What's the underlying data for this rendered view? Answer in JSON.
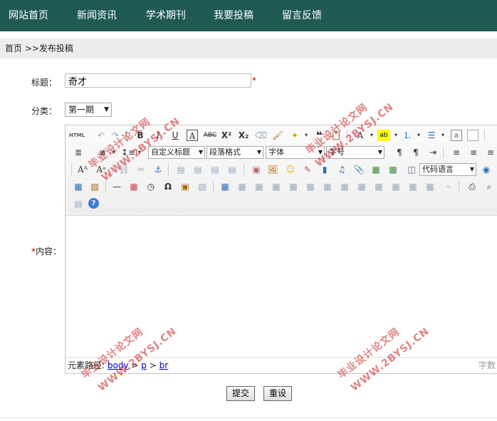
{
  "nav": {
    "items": [
      "网站首页",
      "新闻资讯",
      "学术期刊",
      "我要投稿",
      "留言反馈"
    ]
  },
  "breadcrumb": "首页 >>发布投稿",
  "form": {
    "title_label": "标题：",
    "title_value": "奇才",
    "required_mark": "*",
    "category_label": "分类：",
    "category_value": "第一期",
    "content_label": "内容："
  },
  "editor": {
    "html_label": "HTML",
    "dropdowns": {
      "heading": "自定义标题",
      "paragraph": "段落格式",
      "font": "字体",
      "size": "字号",
      "code": "代码语言"
    },
    "status": {
      "label": "元素路径:",
      "path": [
        "body",
        "p",
        "br"
      ],
      "sep": ">",
      "right": "字数"
    }
  },
  "buttons": {
    "submit": "提交",
    "reset": "重设"
  },
  "watermark": {
    "line1": "毕业设计论文网",
    "line2": "WWW.2BYSJ.CN"
  },
  "colors": {
    "nav_bg": "#1f5a52",
    "required": "#cc0000",
    "watermark": "#c81e1e"
  }
}
